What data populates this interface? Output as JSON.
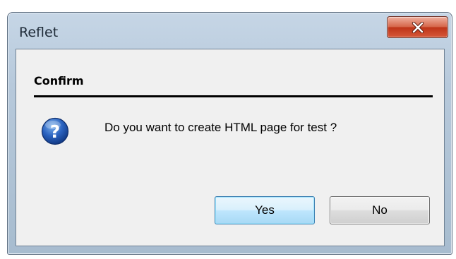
{
  "window": {
    "title": "Reflet"
  },
  "dialog": {
    "heading": "Confirm",
    "message": "Do you want to create HTML page for test ?",
    "icon": "question-icon"
  },
  "buttons": {
    "yes_label": "Yes",
    "no_label": "No"
  },
  "colors": {
    "title_bar": "#b7c9db",
    "close_button": "#c9452a",
    "yes_button": "#bee6fd",
    "no_button": "#dddddd",
    "dialog_background": "#f0f0f0"
  }
}
